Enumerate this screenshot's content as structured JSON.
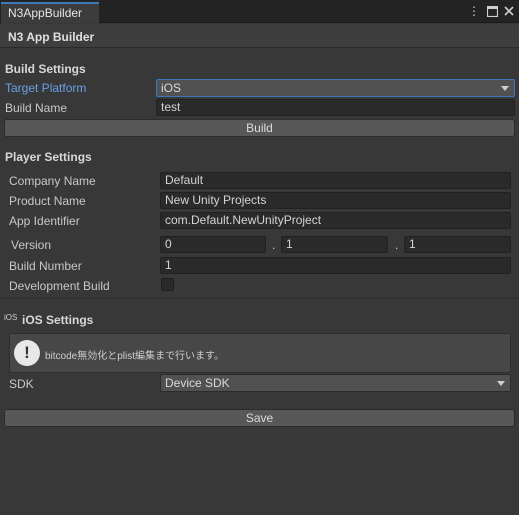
{
  "window": {
    "tab_title": "N3AppBuilder",
    "menu_icon": "kebab-menu-icon",
    "maximize_icon": "maximize-icon",
    "close_icon": "close-icon"
  },
  "header": {
    "title": "N3 App Builder"
  },
  "build_settings": {
    "title": "Build Settings",
    "target_platform_label": "Target Platform",
    "target_platform_value": "iOS",
    "build_name_label": "Build Name",
    "build_name_value": "test",
    "build_button": "Build"
  },
  "player_settings": {
    "title": "Player Settings",
    "company_name_label": "Company Name",
    "company_name_value": "Default",
    "product_name_label": "Product Name",
    "product_name_value": "New Unity Projects",
    "app_identifier_label": "App Identifier",
    "app_identifier_value": "com.Default.NewUnityProject",
    "version_label": "Version",
    "version_major": "0",
    "version_minor": "1",
    "version_patch": "1",
    "version_separator": ".",
    "build_number_label": "Build Number",
    "build_number_value": "1",
    "development_build_label": "Development Build",
    "development_build_checked": false
  },
  "ios_settings": {
    "icon_text": "iOS",
    "title": "iOS Settings",
    "help_text": "bitcode無効化とplist編集まで行います。",
    "help_icon": "info-exclamation-icon",
    "sdk_label": "SDK",
    "sdk_value": "Device SDK"
  },
  "save_button": "Save",
  "colors": {
    "accent": "#3a79bb",
    "highlight_label": "#6aa1e6",
    "background": "#383838"
  }
}
